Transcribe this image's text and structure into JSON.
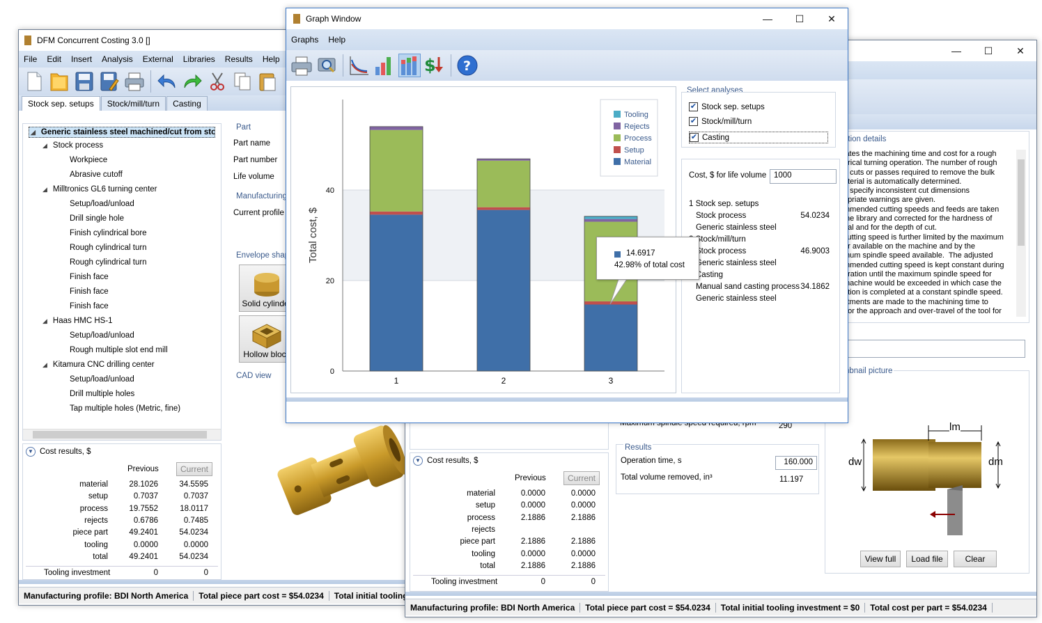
{
  "main_window": {
    "title": "DFM Concurrent Costing 3.0 []",
    "menu": [
      "File",
      "Edit",
      "Insert",
      "Analysis",
      "External",
      "Libraries",
      "Results",
      "Help"
    ],
    "tabs": [
      "Stock sep. setups",
      "Stock/mill/turn",
      "Casting"
    ],
    "tree": [
      {
        "label": "Generic stainless steel machined/cut from stoc",
        "level": 0,
        "expander": true
      },
      {
        "label": "Stock process",
        "level": 1,
        "expander": true
      },
      {
        "label": "Workpiece",
        "level": 2
      },
      {
        "label": "Abrasive cutoff",
        "level": 2
      },
      {
        "label": "Milltronics GL6 turning center",
        "level": 1,
        "expander": true
      },
      {
        "label": "Setup/load/unload",
        "level": 2
      },
      {
        "label": "Drill single hole",
        "level": 2
      },
      {
        "label": "Finish cylindrical bore",
        "level": 2
      },
      {
        "label": "Rough cylindrical turn",
        "level": 2
      },
      {
        "label": "Rough cylindrical turn",
        "level": 2
      },
      {
        "label": "Finish face",
        "level": 2
      },
      {
        "label": "Finish face",
        "level": 2
      },
      {
        "label": "Finish face",
        "level": 2
      },
      {
        "label": "Haas HMC HS-1",
        "level": 1,
        "expander": true
      },
      {
        "label": "Setup/load/unload",
        "level": 2
      },
      {
        "label": "Rough multiple slot end mill",
        "level": 2
      },
      {
        "label": "Kitamura CNC drilling center",
        "level": 1,
        "expander": true
      },
      {
        "label": "Setup/load/unload",
        "level": 2
      },
      {
        "label": "Drill multiple holes",
        "level": 2
      },
      {
        "label": "Tap multiple holes (Metric, fine)",
        "level": 2
      }
    ],
    "part_group": "Part",
    "part_fields": [
      "Part name",
      "Part number",
      "Life volume"
    ],
    "manufacturing_group": "Manufacturing",
    "current_profile_label": "Current profile",
    "envelope_group": "Envelope shape",
    "envelope_buttons": [
      "Solid cylinder",
      "Hollow block"
    ],
    "cad_view": "CAD view",
    "cost_results": {
      "title": "Cost results, $",
      "col_previous": "Previous",
      "col_current": "Current",
      "rows": [
        {
          "label": "material",
          "prev": "28.1026",
          "cur": "34.5595"
        },
        {
          "label": "setup",
          "prev": "0.7037",
          "cur": "0.7037"
        },
        {
          "label": "process",
          "prev": "19.7552",
          "cur": "18.0117"
        },
        {
          "label": "rejects",
          "prev": "0.6786",
          "cur": "0.7485"
        },
        {
          "label": "piece part",
          "prev": "49.2401",
          "cur": "54.0234"
        },
        {
          "label": "tooling",
          "prev": "0.0000",
          "cur": "0.0000"
        },
        {
          "label": "total",
          "prev": "49.2401",
          "cur": "54.0234"
        }
      ],
      "tooling_label": "Tooling investment",
      "tooling_prev": "0",
      "tooling_cur": "0"
    },
    "status": [
      "Manufacturing profile: BDI North America",
      "Total piece part cost = $54.0234",
      "Total initial tooling i"
    ]
  },
  "second_window": {
    "operation_details_title": "ation details",
    "operation_text": "lates the machining time and cost for a rough\ndrical turning operation. The number of rough\ng cuts or passes required to remove the bulk\naterial is automatically determined.\nu specify inconsistent cut dimensions\nopriate warnings are given.\nmmended cutting speeds and feeds are taken\nthe library and corrected for the hardness of\nrial and for the depth of cut.\ncutting speed is further limited by the maximum\ner available on the machine and by the\nmum spindle speed available.  The adjusted\nmmended cutting speed is kept constant during\neration until the maximum spindle speed for\nmachine would be exceeded in which case the\nation is completed at a constant spindle speed.\nstments are made to the machining time to\n for the approach and over-travel of the tool for",
    "notes_title": "s",
    "thumbnail_title": "nbnail picture",
    "thumb_labels": {
      "lm": "lm",
      "dw": "dw",
      "dm": "dm"
    },
    "thumb_buttons": [
      "View full",
      "Load file",
      "Clear"
    ],
    "spindle_label": "Maximum spindle speed required, rpm",
    "spindle_value": "290",
    "results_title": "Results",
    "op_time_label": "Operation time, s",
    "op_time_value": "160.000",
    "volume_label": "Total volume removed, in³",
    "volume_value": "11.197",
    "cost_results": {
      "title": "Cost results, $",
      "col_previous": "Previous",
      "col_current": "Current",
      "rows": [
        {
          "label": "material",
          "prev": "0.0000",
          "cur": "0.0000"
        },
        {
          "label": "setup",
          "prev": "0.0000",
          "cur": "0.0000"
        },
        {
          "label": "process",
          "prev": "2.1886",
          "cur": "2.1886"
        },
        {
          "label": "rejects",
          "prev": "",
          "cur": ""
        },
        {
          "label": "piece part",
          "prev": "2.1886",
          "cur": "2.1886"
        },
        {
          "label": "tooling",
          "prev": "0.0000",
          "cur": "0.0000"
        },
        {
          "label": "total",
          "prev": "2.1886",
          "cur": "2.1886"
        }
      ],
      "tooling_label": "Tooling investment",
      "tooling_prev": "0",
      "tooling_cur": "0"
    },
    "status": [
      "Manufacturing profile: BDI North America",
      "Total piece part cost = $54.0234",
      "Total initial tooling investment = $0",
      "Total cost per part = $54.0234"
    ]
  },
  "graph_window": {
    "title": "Graph Window",
    "menu": [
      "Graphs",
      "Help"
    ],
    "select_title": "Select analyses",
    "analyses": [
      {
        "label": "Stock sep. setups",
        "checked": true
      },
      {
        "label": "Stock/mill/turn",
        "checked": true
      },
      {
        "label": "Casting",
        "checked": true
      }
    ],
    "life_volume_label": "Cost, $ for life volume",
    "life_volume_value": "1000",
    "summary": [
      {
        "text": "1 Stock sep. setups",
        "value": ""
      },
      {
        "text": "Stock process",
        "value": "54.0234",
        "indent": true
      },
      {
        "text": "Generic stainless steel",
        "value": "",
        "indent": true
      },
      {
        "text": "2 Stock/mill/turn",
        "value": ""
      },
      {
        "text": "Stock process",
        "value": "46.9003",
        "indent": true
      },
      {
        "text": "Generic stainless steel",
        "value": "",
        "indent": true
      },
      {
        "text": "Casting",
        "value": "",
        "indent": true
      },
      {
        "text": "Manual sand casting process",
        "value": "34.1862",
        "indent": true
      },
      {
        "text": "Generic stainless steel",
        "value": "",
        "indent": true
      }
    ],
    "tooltip": {
      "value": "14.6917",
      "pct": "42.98% of total cost"
    }
  },
  "chart_data": {
    "type": "bar",
    "stacked": true,
    "categories": [
      "1",
      "2",
      "3"
    ],
    "ylabel": "Total cost, $",
    "ylim": [
      0,
      60
    ],
    "yticks": [
      0,
      20,
      40
    ],
    "legend_position": "top-right",
    "series": [
      {
        "name": "Material",
        "color": "#3f6fa8",
        "values": [
          34.5595,
          35.6,
          14.6917
        ]
      },
      {
        "name": "Setup",
        "color": "#c0504d",
        "values": [
          0.7037,
          0.6,
          0.7
        ]
      },
      {
        "name": "Process",
        "color": "#9bbb59",
        "values": [
          18.0117,
          10.3,
          17.6
        ]
      },
      {
        "name": "Rejects",
        "color": "#8064a2",
        "values": [
          0.7485,
          0.4,
          0.6
        ]
      },
      {
        "name": "Tooling",
        "color": "#4bacc6",
        "values": [
          0,
          0,
          0.6
        ]
      }
    ]
  }
}
